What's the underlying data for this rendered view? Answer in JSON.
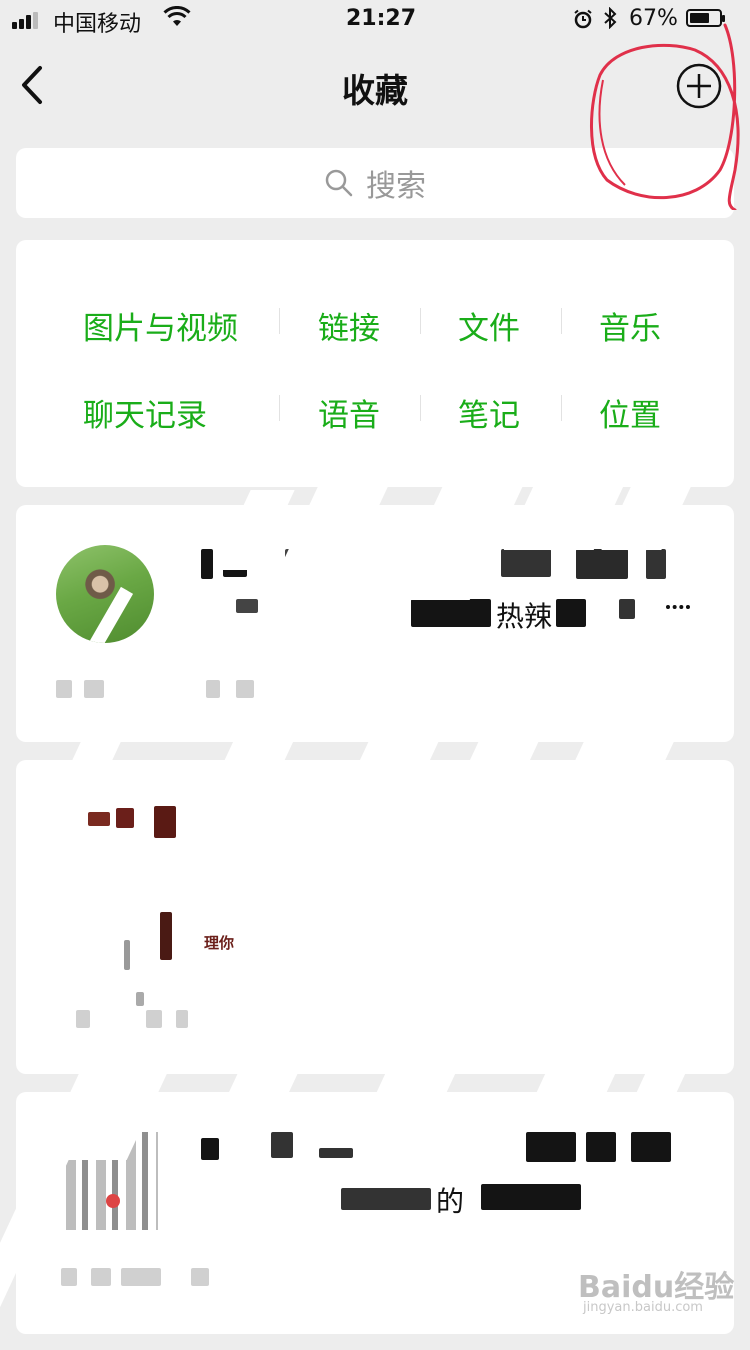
{
  "status_bar": {
    "carrier": "中国移动",
    "time": "21:27",
    "battery_percent": "67%",
    "battery_level": 0.67,
    "icons": [
      "signal-icon",
      "wifi-icon",
      "alarm-icon",
      "bluetooth-icon",
      "battery-icon"
    ]
  },
  "nav": {
    "title": "收藏",
    "back_icon": "chevron-left-icon",
    "add_icon": "plus-circle-icon"
  },
  "search": {
    "placeholder": "搜索",
    "icon": "search-icon"
  },
  "categories": [
    {
      "label": "图片与视频"
    },
    {
      "label": "链接"
    },
    {
      "label": "文件"
    },
    {
      "label": "音乐"
    },
    {
      "label": "聊天记录"
    },
    {
      "label": "语音"
    },
    {
      "label": "笔记"
    },
    {
      "label": "位置"
    }
  ],
  "items": [
    {
      "visible_fragment": "热辣"
    },
    {
      "visible_fragment": "理你"
    },
    {
      "visible_fragment": "的"
    }
  ],
  "watermark": {
    "logo_text": "Baidu经验",
    "url_text": "jingyan.baidu.com"
  },
  "colors": {
    "accent_green": "#1aad19",
    "background": "#ededed",
    "annotation_red": "#e0304a"
  }
}
